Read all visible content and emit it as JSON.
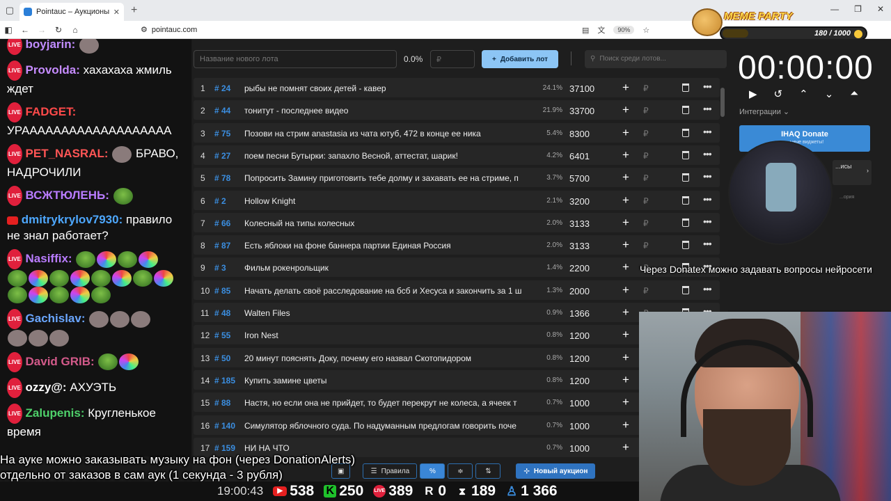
{
  "browser": {
    "tab_title": "Pointauc – Аукционы, лотереи",
    "url": "pointauc.com",
    "zoom": "90%"
  },
  "meme_party": {
    "title": "MEME PARTY",
    "count": "180 / 1000",
    "progress": 0.18
  },
  "chat": {
    "messages": [
      {
        "nick": "boyjarin:",
        "color": "#c08cff",
        "text": ""
      },
      {
        "nick": "Provolda:",
        "color": "#c68cff",
        "text": " хахахаха жмиль ждет"
      },
      {
        "nick": "FADGET:",
        "color": "#ff4a4a",
        "text": " УРААААААААААААААААААА"
      },
      {
        "nick": "PET_NASRAL:",
        "color": "#ff5555",
        "text": " БРАВО, НАДРОЧИЛИ"
      },
      {
        "nick": "ВСЖТЮЛЕНЬ:",
        "color": "#b97cff",
        "text": ""
      },
      {
        "nick": "dmitrykrylov7930:",
        "color": "#4ea8ff",
        "text": " правило не знал работает?"
      },
      {
        "nick": "Nasiffix:",
        "color": "#b97cff",
        "text": ""
      },
      {
        "nick": "Gachislav:",
        "color": "#6aa6ff",
        "text": ""
      },
      {
        "nick": "David GRIB:",
        "color": "#d35a8a",
        "text": ""
      },
      {
        "nick": "ozzy@:",
        "color": "#ffffff",
        "text": " АХУЭТЬ"
      },
      {
        "nick": "Zalupenis:",
        "color": "#4ed06a",
        "text": " Кругленькое время"
      }
    ]
  },
  "auction": {
    "lot_placeholder": "Название нового лота",
    "percent": "0.0%",
    "rub_placeholder": "₽",
    "add_label": "Добавить лот",
    "search_placeholder": "Поиск среди лотов...",
    "currency": "₽",
    "lots": [
      {
        "n": "1",
        "id": "# 24",
        "name": "рыбы не помнят своих детей - кавер",
        "pct": "24.1%",
        "amount": "37100"
      },
      {
        "n": "2",
        "id": "# 44",
        "name": "тонитут - последнее видео",
        "pct": "21.9%",
        "amount": "33700"
      },
      {
        "n": "3",
        "id": "# 75",
        "name": "Позови на стрим anastasia из чата ютуб, 472 в конце ее ника",
        "pct": "5.4%",
        "amount": "8300"
      },
      {
        "n": "4",
        "id": "# 27",
        "name": "поем песни Бутырки: запахло Весной, аттестат, шарик!",
        "pct": "4.2%",
        "amount": "6401"
      },
      {
        "n": "5",
        "id": "# 78",
        "name": "Попросить Замину приготовить тебе долму и захавать ее на стриме, п",
        "pct": "3.7%",
        "amount": "5700"
      },
      {
        "n": "6",
        "id": "# 2",
        "name": "Hollow Knight",
        "pct": "2.1%",
        "amount": "3200"
      },
      {
        "n": "7",
        "id": "# 66",
        "name": "Колесный на типы колесных",
        "pct": "2.0%",
        "amount": "3133"
      },
      {
        "n": "8",
        "id": "# 87",
        "name": "Есть яблоки на фоне баннера партии Единая Россия",
        "pct": "2.0%",
        "amount": "3133"
      },
      {
        "n": "9",
        "id": "# 3",
        "name": "Фильм рокенрольщик",
        "pct": "1.4%",
        "amount": "2200"
      },
      {
        "n": "10",
        "id": "# 85",
        "name": "Начать делать своё расследование на бсб и Хесуса и закончить за 1 ш",
        "pct": "1.3%",
        "amount": "2000"
      },
      {
        "n": "11",
        "id": "# 48",
        "name": "Walten Files",
        "pct": "0.9%",
        "amount": "1366"
      },
      {
        "n": "12",
        "id": "# 55",
        "name": "Iron Nest",
        "pct": "0.8%",
        "amount": "1200"
      },
      {
        "n": "13",
        "id": "# 50",
        "name": "20 минут пояснять Доку, почему его назвал Скотопидором",
        "pct": "0.8%",
        "amount": "1200"
      },
      {
        "n": "14",
        "id": "# 185",
        "name": "Купить замине цветы",
        "pct": "0.8%",
        "amount": "1200"
      },
      {
        "n": "15",
        "id": "# 88",
        "name": "Настя, но если она не прийдет, то будет перекрут не колеса, а ячеек т",
        "pct": "0.7%",
        "amount": "1000"
      },
      {
        "n": "16",
        "id": "# 140",
        "name": "Симулятор яблочного суда. По надуманным предлогам говорить поче",
        "pct": "0.7%",
        "amount": "1000"
      },
      {
        "n": "17",
        "id": "# 159",
        "name": "НИ НА ЧТО",
        "pct": "0.7%",
        "amount": "1000"
      }
    ],
    "rules_label": "Правила",
    "new_auction_label": "Новый аукцион"
  },
  "timer": {
    "value": "00:00:00",
    "integrations_label": "Интеграции",
    "donate_title": "IHAQ Donate",
    "donate_subtitle": "...ьные виджеты!",
    "sidecard_text": "...исы",
    "history_text": "...ория"
  },
  "overlay": {
    "donatex": "Через Donatex можно задавать вопросы нейросети",
    "music_line1": "На ауке можно заказывать музыку на фон (через DonationAlerts)",
    "music_line2": "отдельно от заказов в сам аук (1 секунда - 3 рубля)"
  },
  "stats": {
    "clock": "19:00:43",
    "youtube": "538",
    "kick": "250",
    "live": "389",
    "r": "0",
    "t": "189",
    "total": "1 366"
  }
}
